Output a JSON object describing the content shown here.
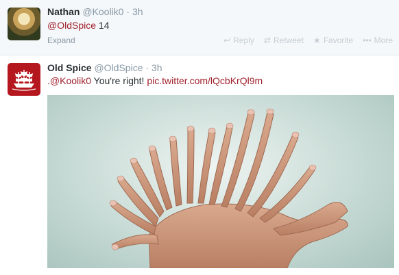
{
  "tweets": [
    {
      "name": "Nathan",
      "handle": "@Koolik0",
      "sep": "·",
      "time": "3h",
      "mention": "@OldSpice",
      "text": " 14",
      "expand": "Expand",
      "actions": {
        "reply": "Reply",
        "retweet": "Retweet",
        "favorite": "Favorite",
        "more": "More"
      }
    },
    {
      "name": "Old Spice",
      "handle": "@OldSpice",
      "sep": "·",
      "time": "3h",
      "mention": ".@Koolik0",
      "text": " You're right! ",
      "link": "pic.twitter.com/lQcbKrQl9m"
    }
  ],
  "colors": {
    "link": "#a01f2a",
    "muted": "#8899a6",
    "brand": "#b4171d"
  }
}
